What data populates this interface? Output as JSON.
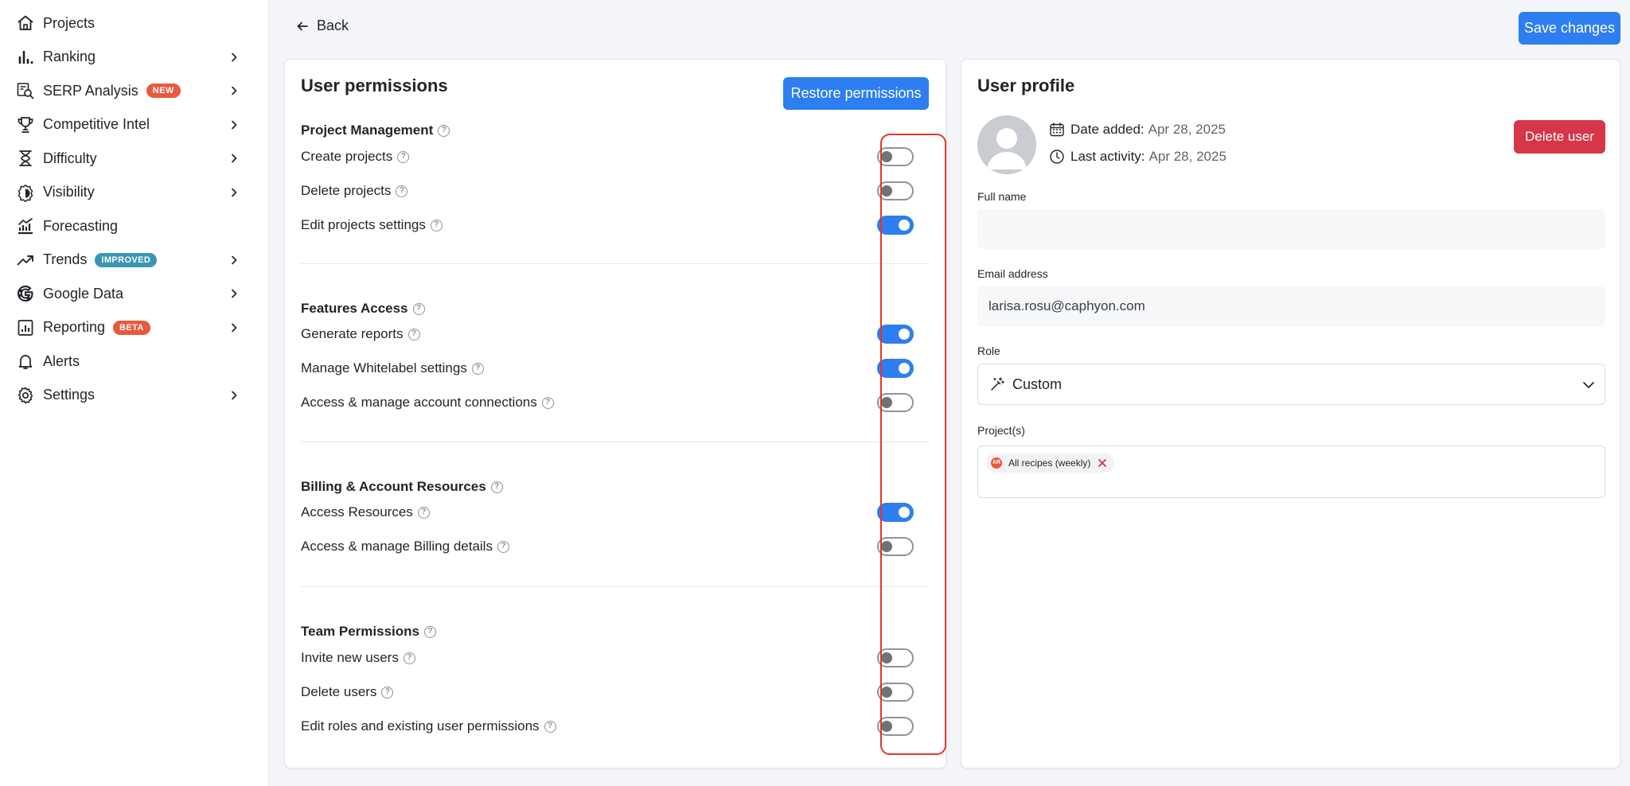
{
  "sidebar": {
    "items": [
      {
        "label": "Projects",
        "badge": "",
        "icon": "home-icon",
        "chevron": false
      },
      {
        "label": "Ranking",
        "badge": "",
        "icon": "bar-chart-icon",
        "chevron": true
      },
      {
        "label": "SERP Analysis",
        "badge": "NEW",
        "icon": "serp-search-icon",
        "chevron": true
      },
      {
        "label": "Competitive Intel",
        "badge": "",
        "icon": "trophy-icon",
        "chevron": true
      },
      {
        "label": "Difficulty",
        "badge": "",
        "icon": "hourglass-icon",
        "chevron": true
      },
      {
        "label": "Visibility",
        "badge": "",
        "icon": "visibility-icon",
        "chevron": true
      },
      {
        "label": "Forecasting",
        "badge": "",
        "icon": "forecast-chart-icon",
        "chevron": false
      },
      {
        "label": "Trends",
        "badge": "IMPROVED",
        "icon": "trend-up-icon",
        "chevron": true
      },
      {
        "label": "Google Data",
        "badge": "",
        "icon": "google-icon",
        "chevron": true
      },
      {
        "label": "Reporting",
        "badge": "BETA",
        "icon": "report-icon",
        "chevron": true
      },
      {
        "label": "Alerts",
        "badge": "",
        "icon": "bell-icon",
        "chevron": false
      },
      {
        "label": "Settings",
        "badge": "",
        "icon": "gear-icon",
        "chevron": true
      }
    ]
  },
  "header": {
    "back_label": "Back",
    "save_label": "Save changes"
  },
  "permissions": {
    "title": "User permissions",
    "restore_label": "Restore permissions",
    "sections": [
      {
        "title": "Project Management",
        "items": [
          {
            "label": "Create projects",
            "enabled": false
          },
          {
            "label": "Delete projects",
            "enabled": false
          },
          {
            "label": "Edit projects settings",
            "enabled": true
          }
        ]
      },
      {
        "title": "Features Access",
        "items": [
          {
            "label": "Generate reports",
            "enabled": true
          },
          {
            "label": "Manage Whitelabel settings",
            "enabled": true
          },
          {
            "label": "Access & manage account connections",
            "enabled": false
          }
        ]
      },
      {
        "title": "Billing & Account Resources",
        "items": [
          {
            "label": "Access Resources",
            "enabled": true
          },
          {
            "label": "Access & manage Billing details",
            "enabled": false
          }
        ]
      },
      {
        "title": "Team Permissions",
        "items": [
          {
            "label": "Invite new users",
            "enabled": false
          },
          {
            "label": "Delete users",
            "enabled": false
          },
          {
            "label": "Edit roles and existing user permissions",
            "enabled": false
          }
        ]
      }
    ]
  },
  "profile": {
    "title": "User profile",
    "date_added_label": "Date added:",
    "date_added_value": "Apr 28, 2025",
    "last_activity_label": "Last activity:",
    "last_activity_value": "Apr 28, 2025",
    "delete_label": "Delete user",
    "full_name_label": "Full name",
    "full_name_value": "",
    "email_label": "Email address",
    "email_value": "larisa.rosu@caphyon.com",
    "role_label": "Role",
    "role_value": "Custom",
    "projects_label": "Project(s)",
    "project_chip": "All recipes (weekly)",
    "project_chip_icon_text": "AR"
  },
  "colors": {
    "accent": "#2d7ef0",
    "danger": "#d63649",
    "highlight": "#e5332a",
    "badge_new": "#e8593d",
    "badge_improved": "#3a96b2"
  }
}
